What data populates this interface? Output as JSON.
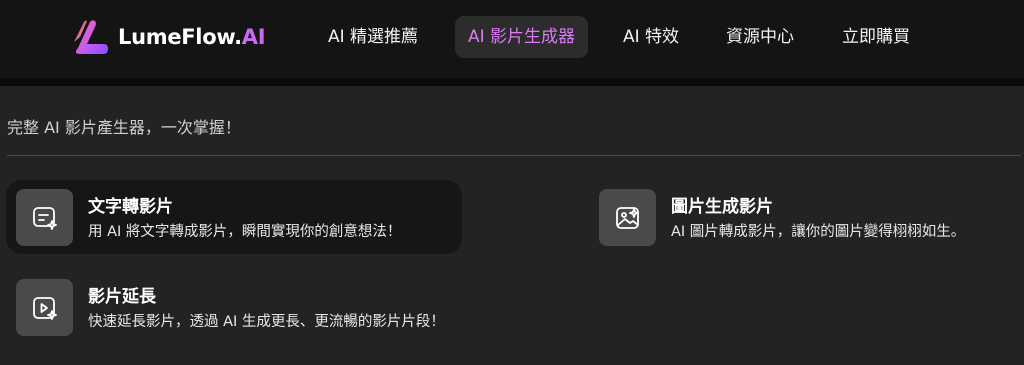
{
  "brand": {
    "name_main": "LumeFlow.",
    "name_accent": "AI",
    "accent_color": "#c86bf0"
  },
  "nav": {
    "items": [
      {
        "label": "AI 精選推薦",
        "active": false
      },
      {
        "label": "AI 影片生成器",
        "active": true
      },
      {
        "label": "AI 特效",
        "active": false
      },
      {
        "label": "資源中心",
        "active": false
      },
      {
        "label": "立即購買",
        "active": false
      }
    ],
    "active_color": "#d97bf2"
  },
  "main": {
    "subtitle": "完整 AI 影片產生器，一次掌握！",
    "cards": [
      {
        "icon": "text-to-video-icon",
        "title": "文字轉影片",
        "desc": "用 AI 將文字轉成影片，瞬間實現你的創意想法！"
      },
      {
        "icon": "image-to-video-icon",
        "title": "圖片生成影片",
        "desc": "AI 圖片轉成影片，讓你的圖片變得栩栩如生。"
      },
      {
        "icon": "video-extend-icon",
        "title": "影片延長",
        "desc": "快速延長影片，透過 AI 生成更長、更流暢的影片片段！"
      }
    ]
  }
}
